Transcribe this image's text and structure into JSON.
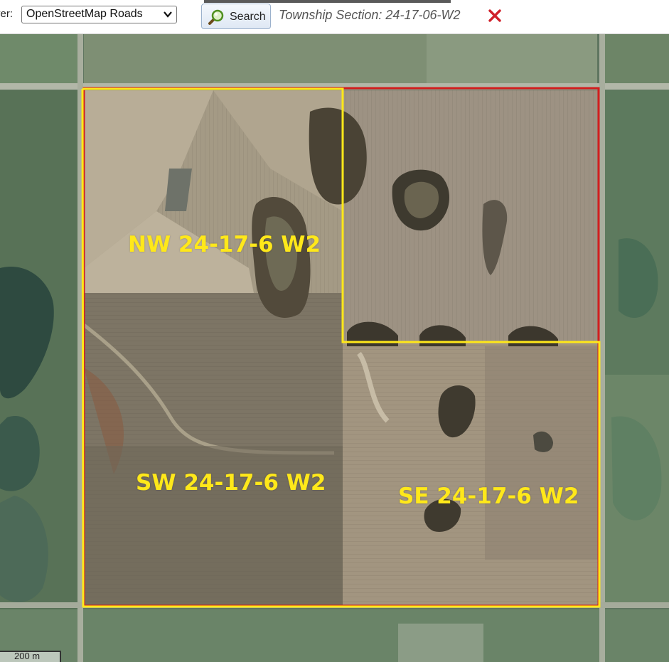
{
  "toolbar": {
    "layer_label": "yer:",
    "layer_select_value": "OpenStreetMap Roads",
    "search_label": "Search",
    "township_section": "Township Section: 24-17-06-W2"
  },
  "map": {
    "quarter_labels": {
      "nw": "NW 24-17-6 W2",
      "sw": "SW 24-17-6 W2",
      "se": "SE 24-17-6 W2"
    },
    "scale_bar": "200 m",
    "colors": {
      "section_outline": "#d21e1e",
      "quarter_outline": "#ffe81a",
      "quarter_label": "#ffe81a"
    }
  },
  "icons": {
    "layer_dropdown": "chevron-down-icon",
    "search": "magnifier-icon",
    "clear": "close-icon"
  }
}
